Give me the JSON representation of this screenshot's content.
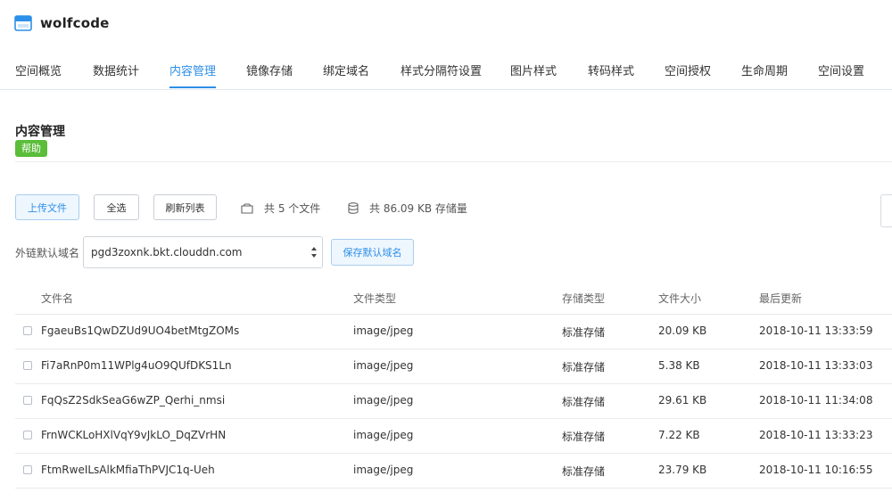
{
  "app": {
    "title": "wolfcode",
    "icon": "bucket-icon"
  },
  "tabs": [
    {
      "label": "空间概览",
      "active": false
    },
    {
      "label": "数据统计",
      "active": false
    },
    {
      "label": "内容管理",
      "active": true
    },
    {
      "label": "镜像存储",
      "active": false
    },
    {
      "label": "绑定域名",
      "active": false
    },
    {
      "label": "样式分隔符设置",
      "active": false
    },
    {
      "label": "图片样式",
      "active": false
    },
    {
      "label": "转码样式",
      "active": false
    },
    {
      "label": "空间授权",
      "active": false
    },
    {
      "label": "生命周期",
      "active": false
    },
    {
      "label": "空间设置",
      "active": false
    }
  ],
  "section": {
    "title": "内容管理",
    "help_label": "帮助"
  },
  "toolbar": {
    "upload_label": "上传文件",
    "select_all_label": "全选",
    "refresh_label": "刷新列表",
    "file_count_text": "共 5 个文件",
    "storage_text": "共 86.09 KB 存储量"
  },
  "domain": {
    "label": "外链默认域名",
    "selected": "pgd3zoxnk.bkt.clouddn.com",
    "save_label": "保存默认域名"
  },
  "table": {
    "headers": [
      "文件名",
      "文件类型",
      "存储类型",
      "文件大小",
      "最后更新"
    ],
    "rows": [
      [
        "FgaeuBs1QwDZUd9UO4betMtgZOMs",
        "image/jpeg",
        "标准存储",
        "20.09 KB",
        "2018-10-11 13:33:59"
      ],
      [
        "Fi7aRnP0m11WPlg4uO9QUfDKS1Ln",
        "image/jpeg",
        "标准存储",
        "5.38 KB",
        "2018-10-11 13:33:03"
      ],
      [
        "FqQsZ2SdkSeaG6wZP_Qerhi_nmsi",
        "image/jpeg",
        "标准存储",
        "29.61 KB",
        "2018-10-11 11:34:08"
      ],
      [
        "FrnWCKLoHXlVqY9vJkLO_DqZVrHN",
        "image/jpeg",
        "标准存储",
        "7.22 KB",
        "2018-10-11 13:33:23"
      ],
      [
        "FtmRweILsAlkMfiaThPVJC1q-Ueh",
        "image/jpeg",
        "标准存储",
        "23.79 KB",
        "2018-10-11 10:16:55"
      ]
    ]
  },
  "colors": {
    "accent": "#2c8fe8",
    "help_badge": "#5bbd3a"
  }
}
